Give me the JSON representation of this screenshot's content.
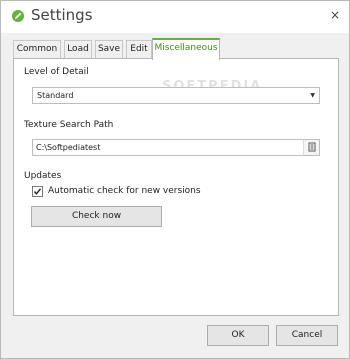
{
  "window": {
    "title": "Settings",
    "close_glyph": "×",
    "icon": "pencil-icon",
    "accent_color": "#5fb536"
  },
  "watermark": "SOFTPEDIA",
  "tabs": [
    {
      "label": "Common",
      "active": false
    },
    {
      "label": "Load",
      "active": false
    },
    {
      "label": "Save",
      "active": false
    },
    {
      "label": "Edit",
      "active": false
    },
    {
      "label": "Miscellaneous",
      "active": true
    }
  ],
  "misc": {
    "level_of_detail": {
      "label": "Level of Detail",
      "selected": "Standard"
    },
    "texture_search_path": {
      "label": "Texture Search Path",
      "value": "C:\\Softpediatest"
    },
    "updates": {
      "label": "Updates",
      "auto_check_label": "Automatic check for new versions",
      "auto_check_checked": true,
      "check_now_label": "Check now"
    }
  },
  "footer": {
    "ok_label": "OK",
    "cancel_label": "Cancel"
  }
}
